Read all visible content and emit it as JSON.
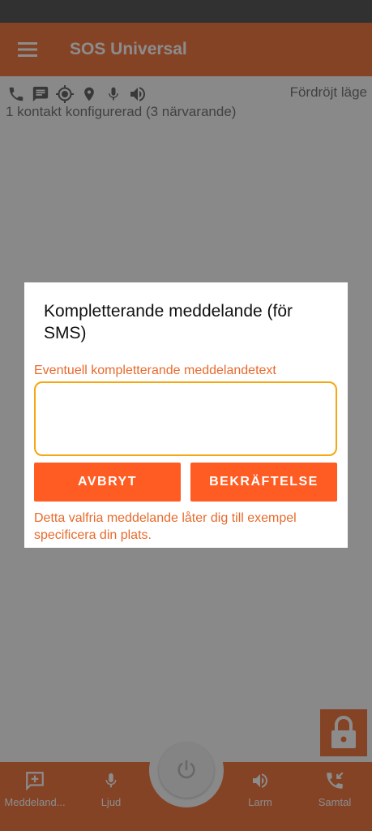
{
  "app": {
    "title": "SOS Universal"
  },
  "icons": [
    "phone-icon",
    "message-icon",
    "gps-target-icon",
    "location-pin-icon",
    "microphone-icon",
    "speaker-icon"
  ],
  "status": {
    "mode": "Fördröjt läge",
    "contacts": "1 kontakt konfigurerad (3 närvarande)"
  },
  "dialog": {
    "title": "Kompletterande meddelande (för SMS)",
    "hint": "Eventuell kompletterande meddelandetext",
    "input_value": "",
    "cancel_label": "AVBRYT",
    "confirm_label": "BEKRÄFTELSE",
    "note": "Detta valfria meddelande låter dig till exempel specificera din plats."
  },
  "bottom_nav": {
    "message": "Meddeland...",
    "sound": "Ljud",
    "alarm": "Larm",
    "call": "Samtal"
  },
  "colors": {
    "accent": "#f27a45",
    "button": "#ff5c23",
    "input_border": "#f5a70f",
    "hint_text": "#e86a2c"
  }
}
